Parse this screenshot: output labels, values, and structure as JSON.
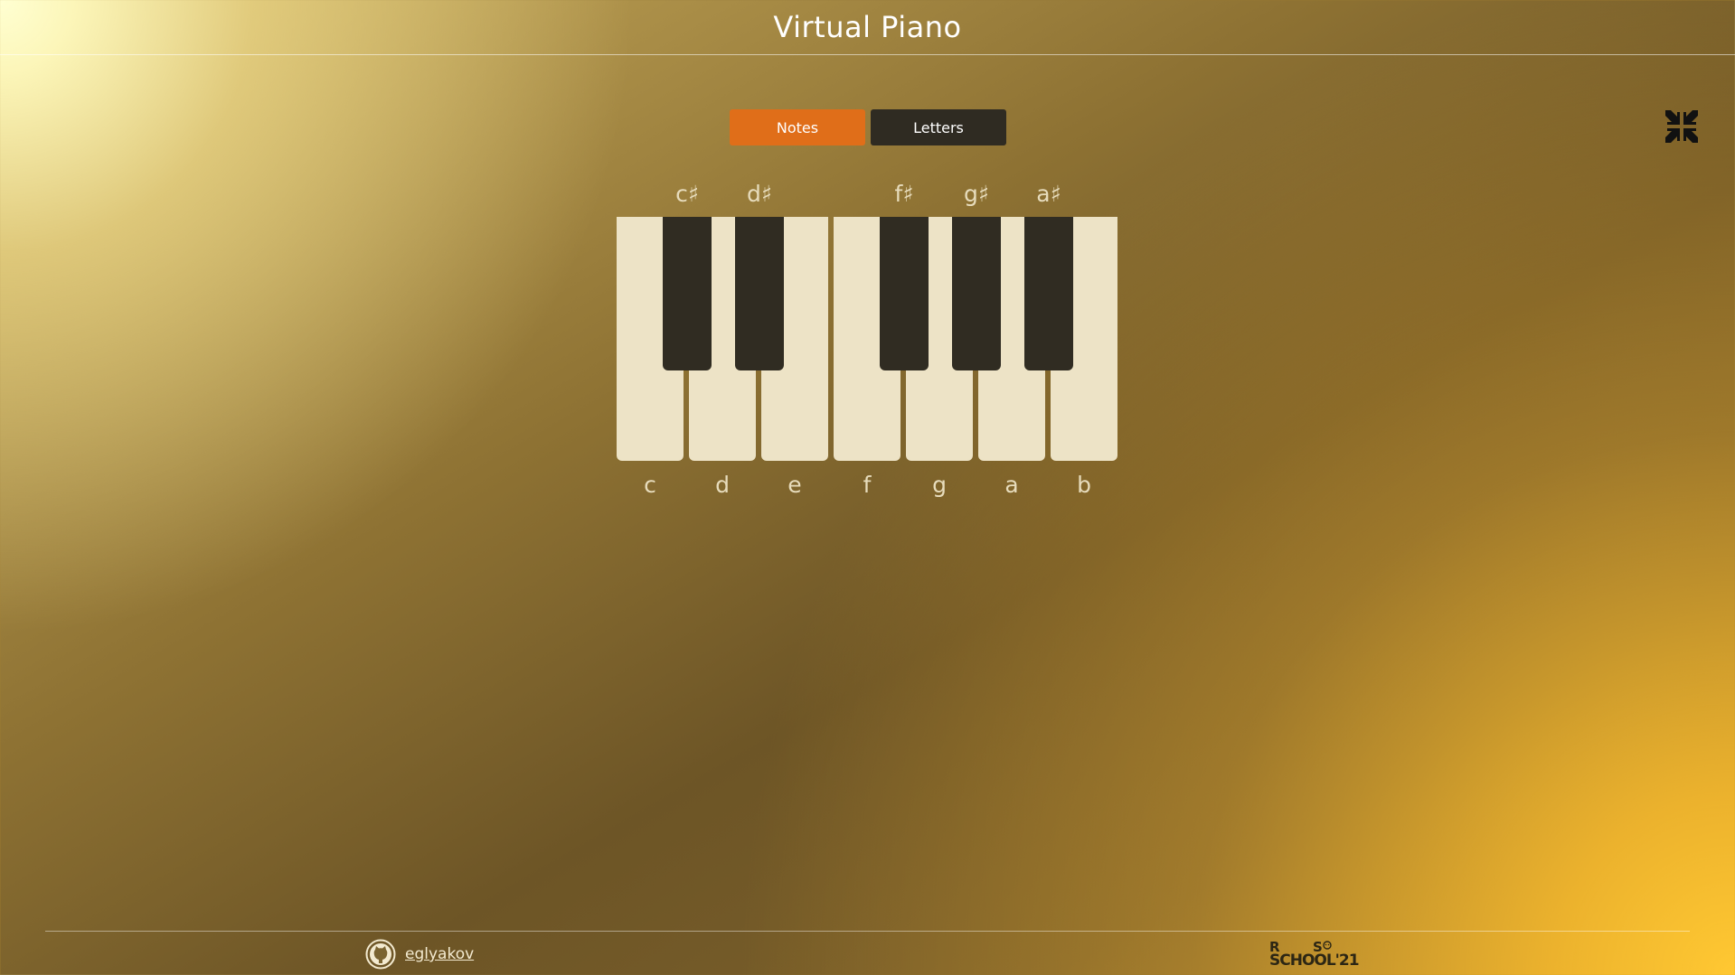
{
  "header": {
    "title": "Virtual Piano"
  },
  "toggle": {
    "notes_label": "Notes",
    "letters_label": "Letters",
    "active": "Notes",
    "active_color": "#e06e19",
    "inactive_color": "#2f2b22"
  },
  "fullscreen_button": {
    "icon": "exit-fullscreen-icon"
  },
  "piano": {
    "white_keys": [
      {
        "note": "c"
      },
      {
        "note": "d"
      },
      {
        "note": "e"
      },
      {
        "note": "f"
      },
      {
        "note": "g"
      },
      {
        "note": "a"
      },
      {
        "note": "b"
      }
    ],
    "black_keys": [
      {
        "note": "c♯"
      },
      {
        "note": "d♯"
      },
      {
        "note": "f♯"
      },
      {
        "note": "g♯"
      },
      {
        "note": "a♯"
      }
    ],
    "white_key_color": "#ede3c6",
    "black_key_color": "#302c22"
  },
  "footer": {
    "github_icon": "github-icon",
    "github_user": "eglyakov",
    "school_logo": {
      "line1_r": "R",
      "line1_s": "S",
      "line2": "SCHOOL'21"
    }
  }
}
